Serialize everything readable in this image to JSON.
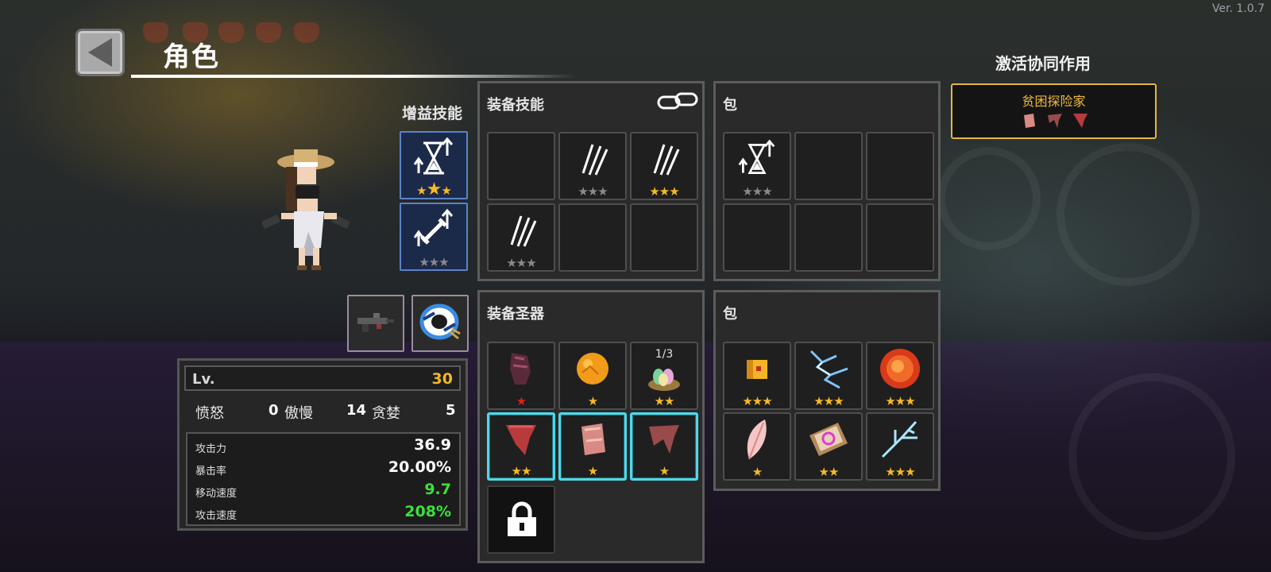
{
  "version": "Ver. 1.0.7",
  "header": {
    "title": "角色"
  },
  "buff_skills": {
    "title": "增益技能",
    "slots": [
      {
        "icon": "hourglass-up-icon",
        "stars": "on,big,on"
      },
      {
        "icon": "sword-up-icon",
        "stars": "off,off,off"
      }
    ]
  },
  "weapons": [
    {
      "icon": "machine-gun-icon"
    },
    {
      "icon": "sailor-cap-icon"
    }
  ],
  "stats": {
    "lv_label": "Lv.",
    "level": "30",
    "sins": [
      {
        "label": "愤怒",
        "value": "0"
      },
      {
        "label": "傲慢",
        "value": "14"
      },
      {
        "label": "贪婪",
        "value": "5"
      }
    ],
    "attributes": [
      {
        "label": "攻击力",
        "value": "36.9",
        "color": "#ffffff"
      },
      {
        "label": "暴击率",
        "value": "20.00%",
        "color": "#ffffff"
      },
      {
        "label": "移动速度",
        "value": "9.7",
        "color": "#3be03b"
      },
      {
        "label": "攻击速度",
        "value": "208%",
        "color": "#3be03b"
      }
    ]
  },
  "equip_skills": {
    "title": "装备技能",
    "link_icon": "chain-link-icon",
    "slots": [
      {
        "icon": "",
        "stars": ""
      },
      {
        "icon": "claw-slash-icon",
        "stars": "off,off,off"
      },
      {
        "icon": "claw-slash-icon",
        "stars": "on,on,on"
      },
      {
        "icon": "claw-slash-icon",
        "stars": "off,off,off"
      },
      {
        "icon": "",
        "stars": ""
      },
      {
        "icon": "",
        "stars": ""
      }
    ]
  },
  "skill_bag": {
    "title": "包",
    "slots": [
      {
        "icon": "hourglass-up-icon",
        "stars": "off,off,off"
      },
      {
        "icon": "",
        "stars": ""
      },
      {
        "icon": "",
        "stars": ""
      },
      {
        "icon": "",
        "stars": ""
      },
      {
        "icon": "",
        "stars": ""
      },
      {
        "icon": "",
        "stars": ""
      }
    ]
  },
  "equip_relics": {
    "title": "装备圣器",
    "slots": [
      {
        "icon": "dark-gauntlet-icon",
        "stars": "red",
        "cyan": false,
        "count": ""
      },
      {
        "icon": "orange-orb-icon",
        "stars": "on",
        "cyan": false,
        "count": ""
      },
      {
        "icon": "egg-nest-icon",
        "stars": "on,on",
        "cyan": false,
        "count": "1/3"
      },
      {
        "icon": "red-cloth-icon",
        "stars": "on,on",
        "cyan": true,
        "count": ""
      },
      {
        "icon": "meat-chunk-icon",
        "stars": "on",
        "cyan": true,
        "count": ""
      },
      {
        "icon": "red-cape-icon",
        "stars": "on",
        "cyan": true,
        "count": ""
      }
    ],
    "lock_icon": "padlock-icon"
  },
  "relic_bag": {
    "title": "包",
    "slots": [
      {
        "icon": "gold-box-icon",
        "stars": "on,on,on"
      },
      {
        "icon": "lightning-icon",
        "stars": "on,on,on"
      },
      {
        "icon": "fire-orb-icon",
        "stars": "on,on,on"
      },
      {
        "icon": "pink-feather-icon",
        "stars": "on"
      },
      {
        "icon": "magic-book-icon",
        "stars": "on,on"
      },
      {
        "icon": "ice-branch-icon",
        "stars": "on,on,on"
      }
    ]
  },
  "synergy": {
    "title": "激活协同作用",
    "name": "贫困探险家",
    "icons": [
      "meat-chunk-icon",
      "red-cape-icon",
      "red-cloth-icon"
    ]
  }
}
